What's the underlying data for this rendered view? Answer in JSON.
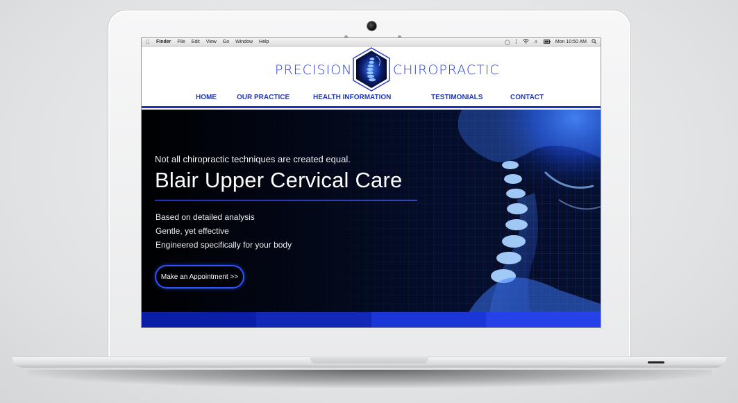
{
  "menubar": {
    "app": "Finder",
    "items": [
      "File",
      "Edit",
      "View",
      "Go",
      "Window",
      "Help"
    ],
    "clock": "Mon 10:50 AM",
    "icons": [
      "apple-icon",
      "spotlight-icon",
      "bluetooth-icon",
      "wifi-icon",
      "volume-icon",
      "battery-icon",
      "search-icon"
    ]
  },
  "site": {
    "logo_left": "PRECISION",
    "logo_right": "CHIROPRACTIC",
    "nav": [
      "HOME",
      "OUR PRACTICE",
      "HEALTH INFORMATION",
      "TESTIMONIALS",
      "CONTACT"
    ]
  },
  "hero": {
    "tagline": "Not all chiropractic techniques are created equal.",
    "headline": "Blair Upper Cervical Care",
    "bullets": [
      "Based on detailed analysis",
      "Gentle, yet effective",
      "Engineered specifically for your body"
    ],
    "cta": "Make an Appointment >>"
  },
  "colors": {
    "brand_blue": "#2236b8",
    "band": [
      "#0a1fa8",
      "#1229b8",
      "#1a36d6",
      "#2442e8"
    ]
  }
}
